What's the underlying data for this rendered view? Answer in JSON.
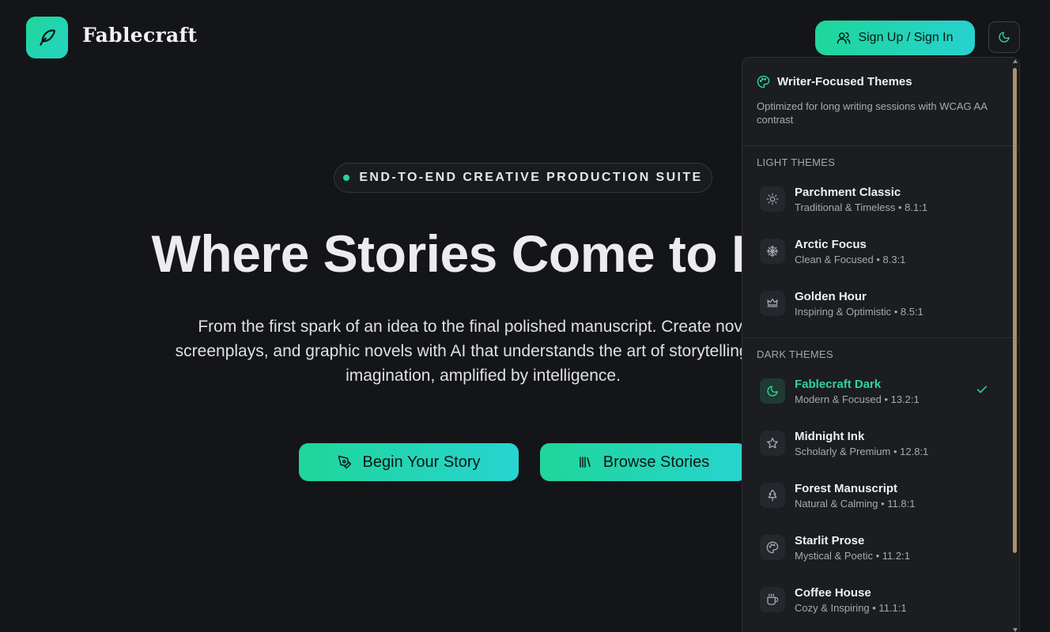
{
  "header": {
    "brand": "Fablecraft",
    "signin_label": "Sign Up / Sign In"
  },
  "hero": {
    "badge": "END-TO-END CREATIVE PRODUCTION SUITE",
    "title": "Where Stories Come to Life",
    "subtitle": "From the first spark of an idea to the final polished manuscript. Create novels, screenplays, and graphic novels with AI that understands the art of storytelling. Your imagination, amplified by intelligence.",
    "begin_label": "Begin Your Story",
    "browse_label": "Browse Stories"
  },
  "theme_menu": {
    "title": "Writer-Focused Themes",
    "description": "Optimized for long writing sessions with WCAG AA contrast",
    "light_label": "LIGHT THEMES",
    "dark_label": "DARK THEMES",
    "light": [
      {
        "name": "Parchment Classic",
        "meta": "Traditional & Timeless • 8.1:1",
        "icon": "sun-icon"
      },
      {
        "name": "Arctic Focus",
        "meta": "Clean & Focused • 8.3:1",
        "icon": "snowflake-icon"
      },
      {
        "name": "Golden Hour",
        "meta": "Inspiring & Optimistic • 8.5:1",
        "icon": "crown-icon"
      }
    ],
    "dark": [
      {
        "name": "Fablecraft Dark",
        "meta": "Modern & Focused • 13.2:1",
        "icon": "moon-icon",
        "selected": true
      },
      {
        "name": "Midnight Ink",
        "meta": "Scholarly & Premium • 12.8:1",
        "icon": "star-icon"
      },
      {
        "name": "Forest Manuscript",
        "meta": "Natural & Calming • 11.8:1",
        "icon": "tree-icon"
      },
      {
        "name": "Starlit Prose",
        "meta": "Mystical & Poetic • 11.2:1",
        "icon": "palette-icon"
      },
      {
        "name": "Coffee House",
        "meta": "Cozy & Inspiring • 11.1:1",
        "icon": "coffee-icon"
      }
    ]
  },
  "colors": {
    "accent": "#1fd69a",
    "accent_end": "#26d2cf",
    "background": "#141518",
    "panel": "#1b1d21",
    "scroll_thumb": "#a8916e"
  }
}
